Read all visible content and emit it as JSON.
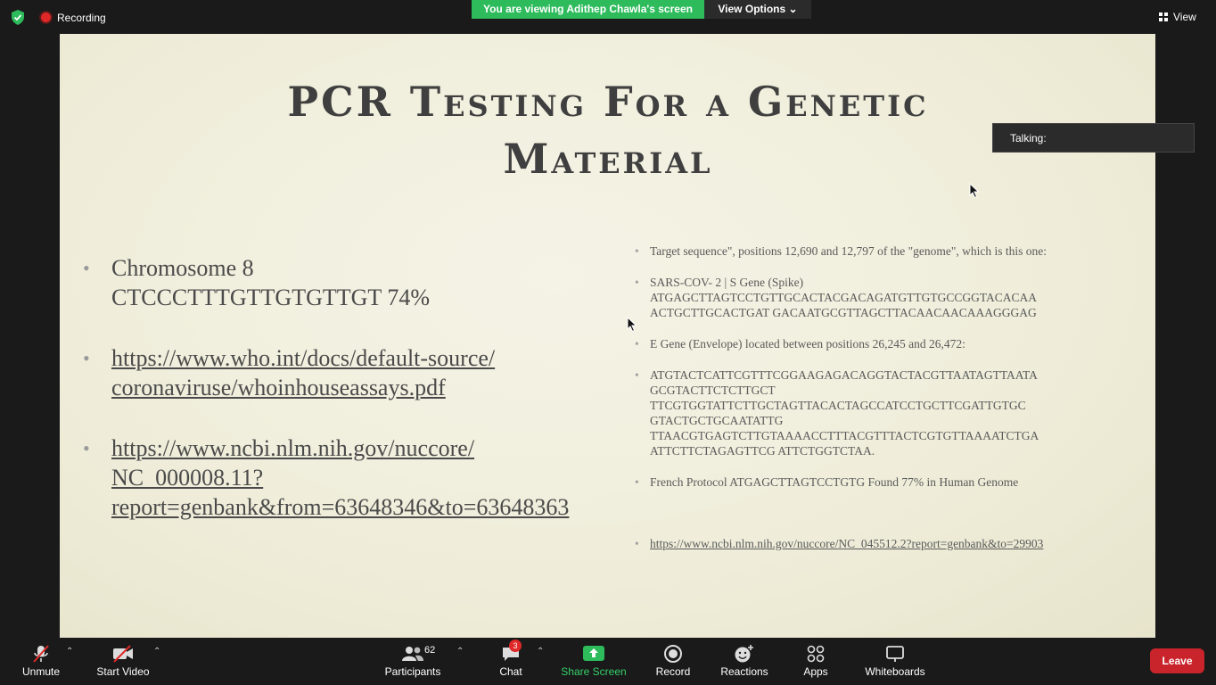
{
  "top_bar": {
    "recording_label": "Recording",
    "viewing_banner": "You are viewing Adithep Chawla's screen",
    "view_options_label": "View Options",
    "view_label": "View"
  },
  "slide": {
    "title_line1": "PCR Testing For a Genetic",
    "title_line2": "Material",
    "left_bullets": [
      {
        "line1": "Chromosome 8",
        "line2": "CTCCCTTTGTTGTGTTGT 74%"
      },
      {
        "line1": "https://www.who.int/docs/default-source/",
        "line2": "coronaviruse/whoinhouseassays.pdf"
      },
      {
        "line1": "https://www.ncbi.nlm.nih.gov/nuccore/",
        "line2": "NC_000008.11?",
        "line3": "report=genbank&from=63648346&to=63648363"
      }
    ],
    "right_bullets": [
      {
        "line1": "Target sequence\", positions 12,690 and 12,797 of the \"genome\", which is this one:"
      },
      {
        "line1": "SARS-COV- 2 | S Gene (Spike)",
        "line2": "ATGAGCTTAGTCCTGTTGCACTACGACAGATGTTGTGCCGGTACACAA",
        "line3": "ACTGCTTGCACTGAT GACAATGCGTTAGCTTACAACAACAAAGGGAG"
      },
      {
        "line1": "E Gene (Envelope) located between positions 26,245 and 26,472:"
      },
      {
        "line1": "ATGTACTCATTCGTTTCGGAAGAGACAGGTACTACGTTAATAGTTAATA",
        "line2": "GCGTACTTCTCTTGCT",
        "line3": "TTCGTGGTATTCTTGCTAGTTACACTAGCCATCCTGCTTCGATTGTGC",
        "line4": "GTACTGCTGCAATATTG",
        "line5": "TTAACGTGAGTCTTGTAAAACCTTTACGTTTACTCGTGTTAAAATCTGA",
        "line6": "ATTCTTCTAGAGTTCG ATTCTGGTCTAA."
      },
      {
        "line1": "French Protocol ATGAGCTTAGTCCTGTG  Found 77% in Human Genome"
      },
      {
        "line1": "https://www.ncbi.nlm.nih.gov/nuccore/NC_045512.2?report=genbank&to=29903"
      }
    ]
  },
  "talking_label": "Talking:",
  "toolbar": {
    "unmute": "Unmute",
    "start_video": "Start Video",
    "participants": "Participants",
    "participants_count": "62",
    "chat": "Chat",
    "chat_badge": "3",
    "share_screen": "Share Screen",
    "record": "Record",
    "reactions": "Reactions",
    "apps": "Apps",
    "whiteboards": "Whiteboards",
    "leave": "Leave"
  },
  "colors": {
    "share_green": "#2dbb5c",
    "leave_red": "#c9242b",
    "slide_bg": "#efedd9"
  }
}
